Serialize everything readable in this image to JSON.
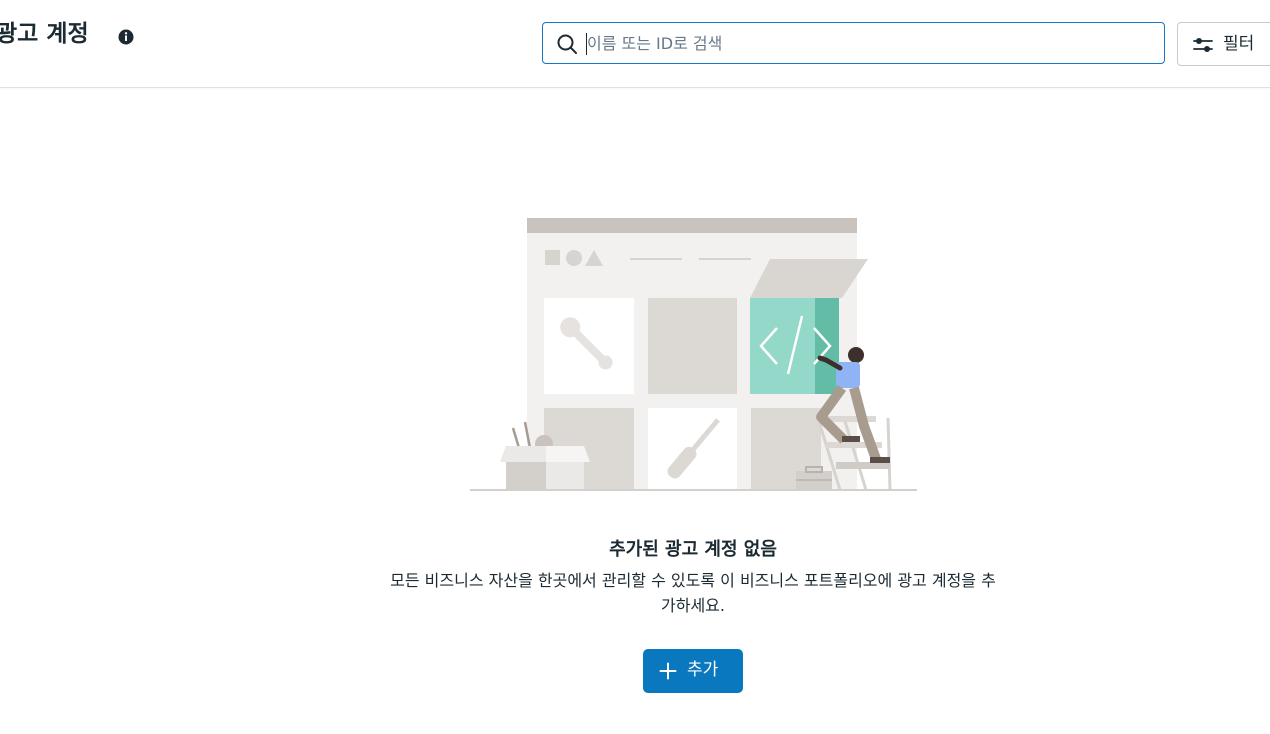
{
  "header": {
    "title": "광고 계정",
    "info_icon": "info-circle-icon",
    "search": {
      "placeholder": "이름 또는 ID로 검색",
      "value": "",
      "icon": "search-icon"
    },
    "filter": {
      "label": "필터",
      "icon": "sliders-icon"
    }
  },
  "empty_state": {
    "illustration": "developer-coding-illustration",
    "title": "추가된 광고 계정 없음",
    "description": "모든 비즈니스 자산을 한곳에서 관리할 수 있도록 이 비즈니스 포트폴리오에 광고 계정을 추가하세요.",
    "add_button": {
      "label": "추가",
      "icon": "plus-icon"
    }
  },
  "colors": {
    "primary": "#0a78be",
    "search_border": "#1876c6",
    "text": "#1c2b33",
    "placeholder": "#67788a",
    "illustration_teal": "#93d8c9",
    "illustration_person": "#8fb3f5"
  }
}
